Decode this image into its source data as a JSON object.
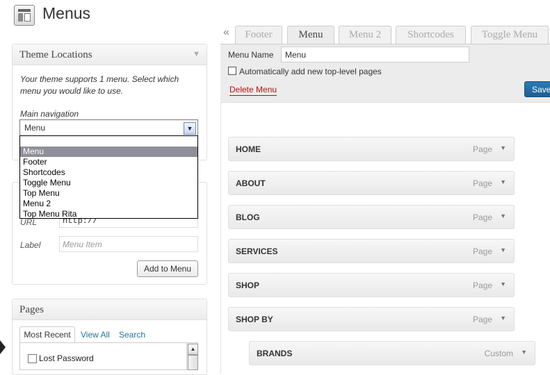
{
  "header": {
    "title": "Menus",
    "icon": "menus-screen-icon"
  },
  "theme_locations": {
    "title": "Theme Locations",
    "description": "Your theme supports 1 menu. Select which menu you would like to use.",
    "main_navigation_label": "Main navigation",
    "selected": "Menu",
    "dropdown_options": [
      "",
      "Menu",
      "Footer",
      "Shortcodes",
      "Toggle Menu",
      "Top Menu",
      "Menu 2",
      "Top Menu Rita"
    ]
  },
  "custom_links": {
    "url_label": "URL",
    "url_value": "http://",
    "label_label": "Label",
    "label_placeholder": "Menu Item",
    "add_button": "Add to Menu"
  },
  "pages": {
    "title": "Pages",
    "tabs": [
      "Most Recent",
      "View All",
      "Search"
    ],
    "items": [
      "Lost Password"
    ]
  },
  "menu_tabs": [
    "Footer",
    "Menu",
    "Menu 2",
    "Shortcodes",
    "Toggle Menu"
  ],
  "active_tab": "Menu",
  "menu_editor": {
    "name_label": "Menu Name",
    "name_value": "Menu",
    "auto_add_label": "Automatically add new top-level pages",
    "auto_add_checked": false,
    "delete_label": "Delete Menu",
    "save_label": "Save"
  },
  "menu_items": [
    {
      "title": "HOME",
      "type": "Page",
      "depth": 0
    },
    {
      "title": "ABOUT",
      "type": "Page",
      "depth": 0
    },
    {
      "title": "BLOG",
      "type": "Page",
      "depth": 0
    },
    {
      "title": "SERVICES",
      "type": "Page",
      "depth": 0
    },
    {
      "title": "SHOP",
      "type": "Page",
      "depth": 0
    },
    {
      "title": "SHOP BY",
      "type": "Page",
      "depth": 0
    },
    {
      "title": "BRANDS",
      "type": "Custom",
      "depth": 1
    }
  ],
  "colors": {
    "link": "#21759b",
    "delete": "#bc0b0b",
    "save": "#21759b"
  }
}
